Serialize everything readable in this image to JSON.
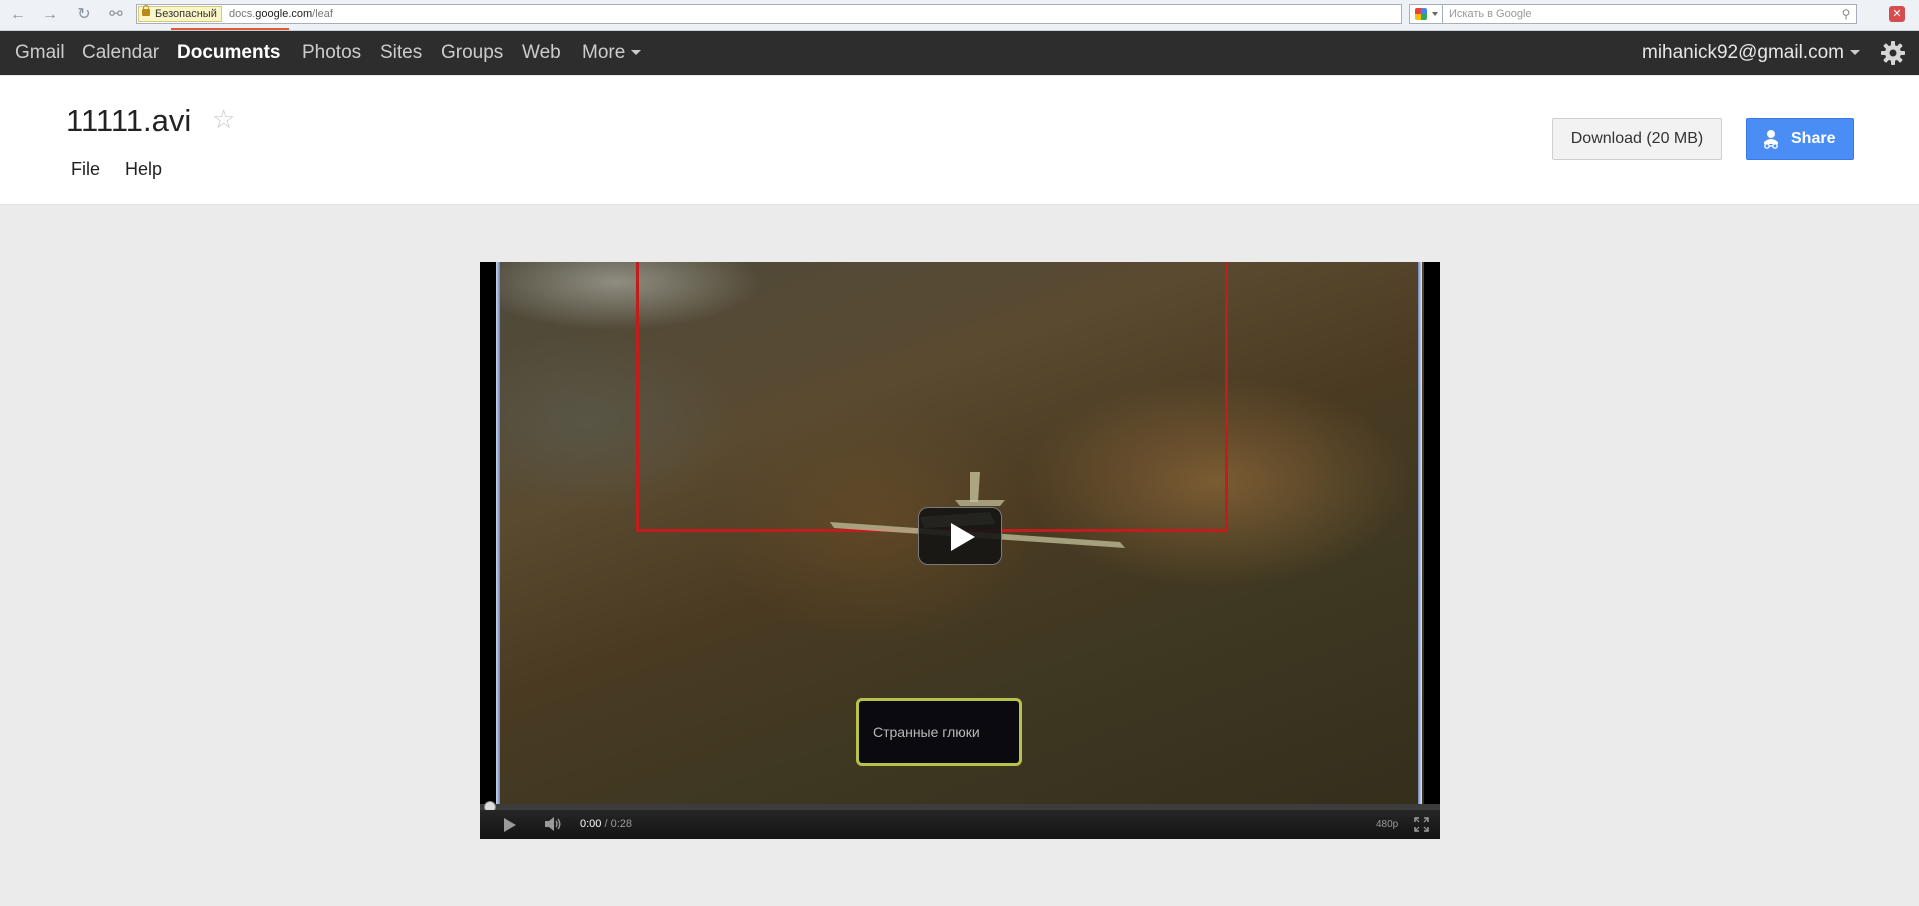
{
  "browser": {
    "security_label": "Безопасный",
    "url_prefix": "docs.",
    "url_domain": "google.com",
    "url_path": "/leaf",
    "search_placeholder": "Искать в Google"
  },
  "gbar": {
    "items": [
      {
        "label": "Gmail",
        "active": false
      },
      {
        "label": "Calendar",
        "active": false
      },
      {
        "label": "Documents",
        "active": true
      },
      {
        "label": "Photos",
        "active": false
      },
      {
        "label": "Sites",
        "active": false
      },
      {
        "label": "Groups",
        "active": false
      },
      {
        "label": "Web",
        "active": false
      }
    ],
    "more_label": "More",
    "account": "mihanick92@gmail.com"
  },
  "doc": {
    "title": "11111.avi",
    "menu": {
      "file": "File",
      "help": "Help"
    },
    "download_label": "Download (20 MB)",
    "share_label": "Share"
  },
  "player": {
    "caption": "Странные глюки",
    "current_time": "0:00",
    "separator": " / ",
    "duration": "0:28",
    "quality": "480p",
    "progress": 0
  },
  "colors": {
    "gbar_bg": "#2d2d2d",
    "share_blue": "#4a8df5",
    "page_bg": "#ebebeb",
    "frame_red": "#c11d1d",
    "caption_border": "#b7c24a"
  }
}
